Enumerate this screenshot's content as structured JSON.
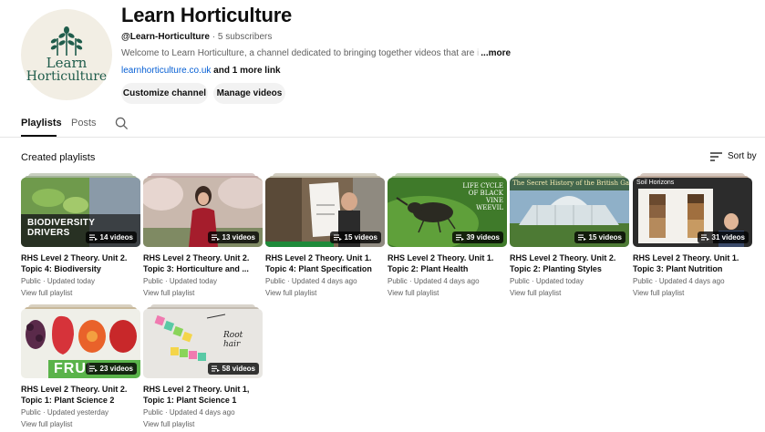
{
  "channel": {
    "logo_line1": "Learn",
    "logo_line2": "Horticulture",
    "title": "Learn Horticulture",
    "handle": "@Learn-Horticulture",
    "separator": " · ",
    "subscribers": "5 subscribers",
    "description_visible": "Welcome to Learn Horticulture, a channel dedicated to bringing together videos that are",
    "description_faded": " i",
    "more_label": "...more",
    "link_url": "learnhorticulture.co.uk",
    "link_more": " and 1 more link",
    "customize_label": "Customize channel",
    "manage_label": "Manage videos",
    "brand_color": "#1f5c4b"
  },
  "tabs": [
    {
      "label": "Playlists",
      "active": true
    },
    {
      "label": "Posts",
      "active": false
    }
  ],
  "section": {
    "title": "Created playlists",
    "sort_label": "Sort by"
  },
  "playlists": [
    {
      "title": "RHS Level 2 Theory. Unit 2. Topic 4: Biodiversity",
      "visibility": "Public",
      "updated": "Updated today",
      "count": "14 videos",
      "link": "View full playlist",
      "thumb_text": "BIODIVERSITY DRIVERS"
    },
    {
      "title": "RHS Level 2 Theory. Unit 2. Topic 3: Horticulture and ...",
      "visibility": "Public",
      "updated": "Updated today",
      "count": "13 videos",
      "link": "View full playlist"
    },
    {
      "title": "RHS Level 2 Theory. Unit 1. Topic 4: Plant Specification",
      "visibility": "Public",
      "updated": "Updated 4 days ago",
      "count": "15 videos",
      "link": "View full playlist"
    },
    {
      "title": "RHS Level 2 Theory. Unit 1. Topic 2: Plant Health",
      "visibility": "Public",
      "updated": "Updated 4 days ago",
      "count": "39 videos",
      "link": "View full playlist",
      "thumb_text": "LIFE CYCLE OF BLACK VINE WEEVIL"
    },
    {
      "title": "RHS Level 2 Theory. Unit 2. Topic 2: Planting Styles",
      "visibility": "Public",
      "updated": "Updated today",
      "count": "15 videos",
      "link": "View full playlist",
      "thumb_text": "The Secret History of the British Garden"
    },
    {
      "title": "RHS Level 2 Theory. Unit 1. Topic 3: Plant Nutrition",
      "visibility": "Public",
      "updated": "Updated 4 days ago",
      "count": "31 videos",
      "link": "View full playlist",
      "thumb_text": "Soil Horizons"
    },
    {
      "title": "RHS Level 2 Theory. Unit 2. Topic 1: Plant Science 2",
      "visibility": "Public",
      "updated": "Updated yesterday",
      "count": "23 videos",
      "link": "View full playlist",
      "thumb_text": "FRUI"
    },
    {
      "title": "RHS Level 2 Theory. Unit 1, Topic 1: Plant Science 1",
      "visibility": "Public",
      "updated": "Updated 4 days ago",
      "count": "58 videos",
      "link": "View full playlist",
      "thumb_text": "Root hair"
    }
  ],
  "icons": {
    "search": "search-icon",
    "sort": "sort-icon",
    "playlist": "playlist-icon"
  }
}
